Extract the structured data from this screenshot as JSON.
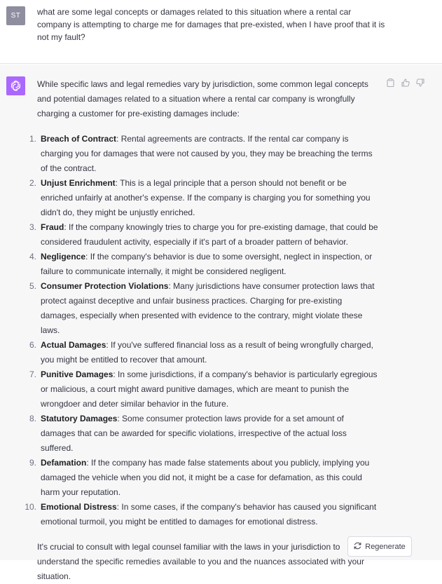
{
  "user": {
    "initials": "ST",
    "message": "what are some legal concepts or damages related to this situation where a rental car company is attempting to charge me for damages that pre-existed, when I have proof that it is not my fault?"
  },
  "assistant": {
    "intro": "While specific laws and legal remedies vary by jurisdiction, some common legal concepts and potential damages related to a situation where a rental car company is wrongfully charging a customer for pre-existing damages include:",
    "items": [
      {
        "num": "1.",
        "term": "Breach of Contract",
        "text": ": Rental agreements are contracts. If the rental car company is charging you for damages that were not caused by you, they may be breaching the terms of the contract."
      },
      {
        "num": "2.",
        "term": "Unjust Enrichment",
        "text": ": This is a legal principle that a person should not benefit or be enriched unfairly at another's expense. If the company is charging you for something you didn't do, they might be unjustly enriched."
      },
      {
        "num": "3.",
        "term": "Fraud",
        "text": ": If the company knowingly tries to charge you for pre-existing damage, that could be considered fraudulent activity, especially if it's part of a broader pattern of behavior."
      },
      {
        "num": "4.",
        "term": "Negligence",
        "text": ": If the company's behavior is due to some oversight, neglect in inspection, or failure to communicate internally, it might be considered negligent."
      },
      {
        "num": "5.",
        "term": "Consumer Protection Violations",
        "text": ": Many jurisdictions have consumer protection laws that protect against deceptive and unfair business practices. Charging for pre-existing damages, especially when presented with evidence to the contrary, might violate these laws."
      },
      {
        "num": "6.",
        "term": "Actual Damages",
        "text": ": If you've suffered financial loss as a result of being wrongfully charged, you might be entitled to recover that amount."
      },
      {
        "num": "7.",
        "term": "Punitive Damages",
        "text": ": In some jurisdictions, if a company's behavior is particularly egregious or malicious, a court might award punitive damages, which are meant to punish the wrongdoer and deter similar behavior in the future."
      },
      {
        "num": "8.",
        "term": "Statutory Damages",
        "text": ": Some consumer protection laws provide for a set amount of damages that can be awarded for specific violations, irrespective of the actual loss suffered."
      },
      {
        "num": "9.",
        "term": "Defamation",
        "text": ": If the company has made false statements about you publicly, implying you damaged the vehicle when you did not, it might be a case for defamation, as this could harm your reputation."
      },
      {
        "num": "10.",
        "term": "Emotional Distress",
        "text": ": In some cases, if the company's behavior has caused you significant emotional turmoil, you might be entitled to damages for emotional distress."
      }
    ],
    "outro": "It's crucial to consult with legal counsel familiar with the laws in your jurisdiction to understand the specific remedies available to you and the nuances associated with your situation."
  },
  "icons": {
    "copy": "clipboard-icon",
    "thumbs_up": "thumbs-up-icon",
    "thumbs_down": "thumbs-down-icon",
    "regenerate": "refresh-icon",
    "assistant_avatar": "openai-logo-icon"
  },
  "regenerate_label": "Regenerate",
  "colors": {
    "assistant_avatar_bg": "#ab68ff",
    "user_avatar_bg": "#8e8ea0",
    "assistant_bg": "#f7f7f8"
  }
}
